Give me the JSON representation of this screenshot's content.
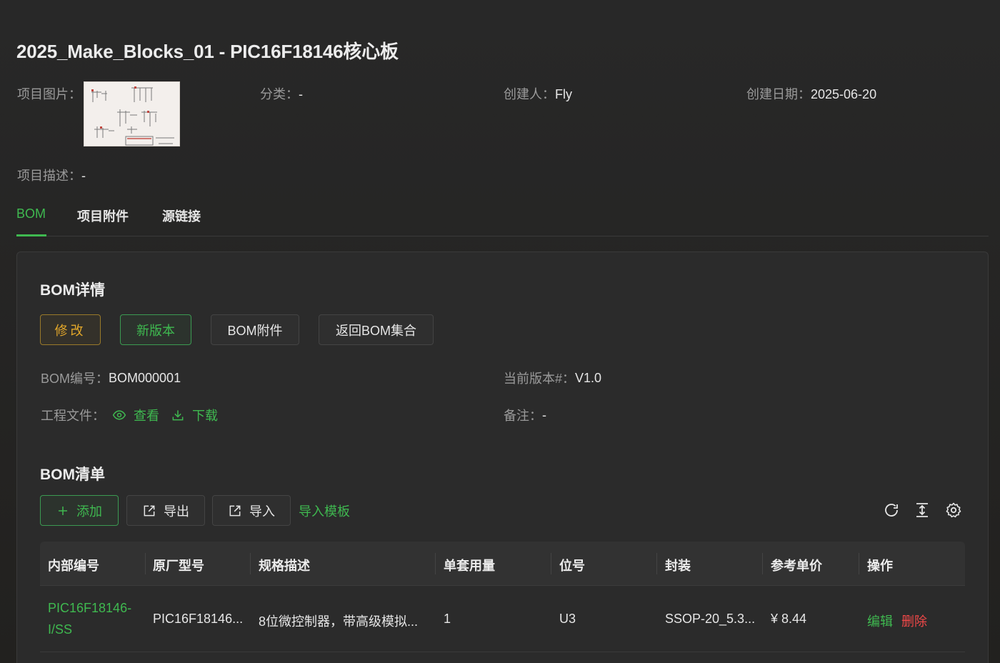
{
  "project": {
    "title": "2025_Make_Blocks_01 - PIC16F18146核心板",
    "image_label": "项目图片：",
    "category_label": "分类：",
    "category_value": "-",
    "creator_label": "创建人：",
    "creator_value": "Fly",
    "created_label": "创建日期：",
    "created_value": "2025-06-20",
    "desc_label": "项目描述：",
    "desc_value": "-"
  },
  "tabs": [
    {
      "label": "BOM",
      "active": true
    },
    {
      "label": "项目附件",
      "active": false
    },
    {
      "label": "源链接",
      "active": false
    }
  ],
  "bom_detail": {
    "title": "BOM详情",
    "buttons": {
      "edit": "修改",
      "new_version": "新版本",
      "attachment": "BOM附件",
      "back": "返回BOM集合"
    },
    "number_label": "BOM编号：",
    "number_value": "BOM000001",
    "version_label": "当前版本#：",
    "version_value": "V1.0",
    "file_label": "工程文件：",
    "view_label": "查看",
    "download_label": "下载",
    "note_label": "备注：",
    "note_value": "-"
  },
  "bom_list": {
    "title": "BOM清单",
    "add_label": "添加",
    "export_label": "导出",
    "import_label": "导入",
    "template_label": "导入模板",
    "columns": [
      "内部编号",
      "原厂型号",
      "规格描述",
      "单套用量",
      "位号",
      "封装",
      "参考单价",
      "操作"
    ],
    "rows": [
      {
        "internal_no": "PIC16F18146-I/SS",
        "mfr_part": "PIC16F18146...",
        "spec": "8位微控制器，带高级模拟...",
        "qty": "1",
        "designator": "U3",
        "package": "SSOP-20_5.3...",
        "price": "¥ 8.44",
        "edit": "编辑",
        "delete": "删除"
      }
    ]
  },
  "colors": {
    "accent": "#3fb950",
    "warn": "#e2a72a",
    "danger": "#f04848"
  },
  "icons": [
    "eye-icon",
    "download-icon",
    "plus-icon",
    "export-icon",
    "import-icon",
    "refresh-icon",
    "column-height-icon",
    "settings-icon"
  ]
}
